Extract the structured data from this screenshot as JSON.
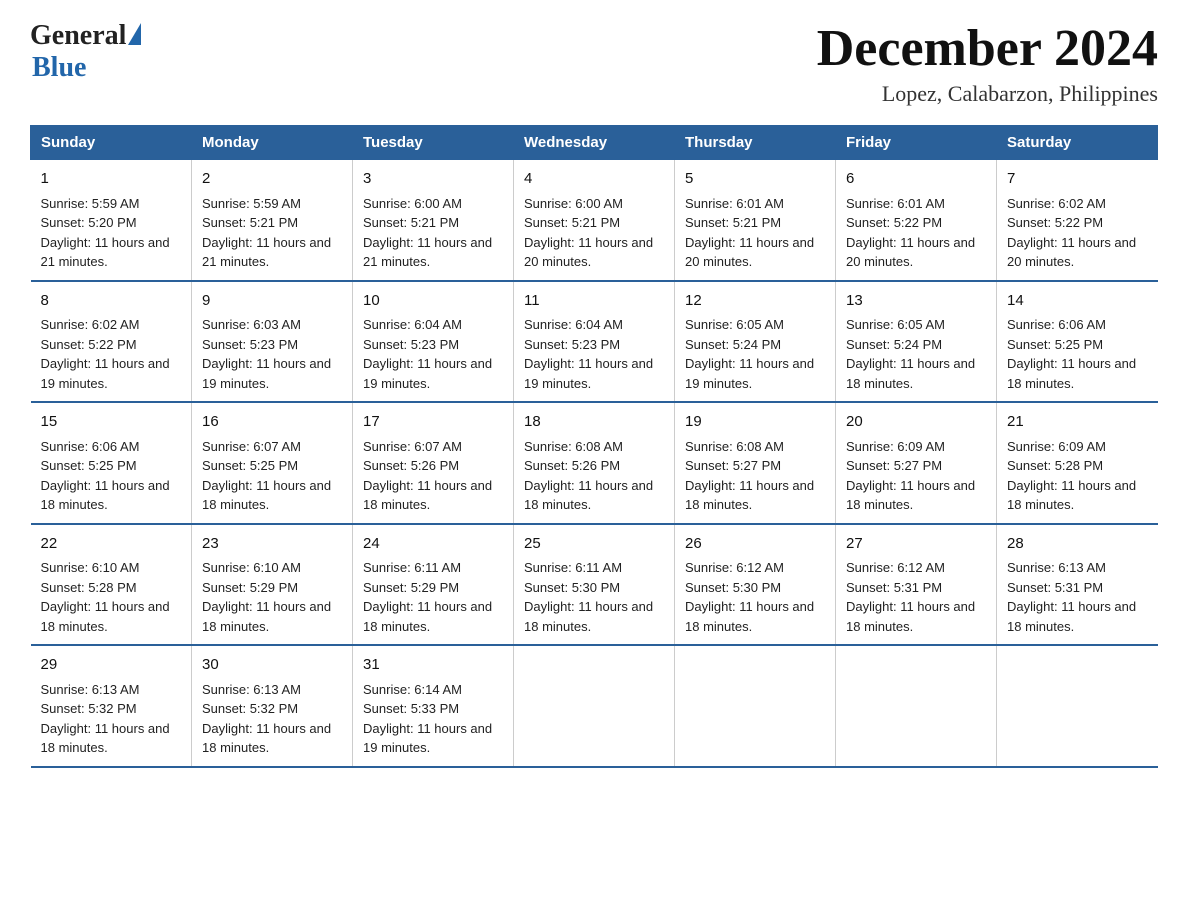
{
  "header": {
    "logo_general": "General",
    "logo_blue": "Blue",
    "month_title": "December 2024",
    "location": "Lopez, Calabarzon, Philippines"
  },
  "days_of_week": [
    "Sunday",
    "Monday",
    "Tuesday",
    "Wednesday",
    "Thursday",
    "Friday",
    "Saturday"
  ],
  "weeks": [
    [
      {
        "day": "1",
        "sunrise": "5:59 AM",
        "sunset": "5:20 PM",
        "daylight": "11 hours and 21 minutes."
      },
      {
        "day": "2",
        "sunrise": "5:59 AM",
        "sunset": "5:21 PM",
        "daylight": "11 hours and 21 minutes."
      },
      {
        "day": "3",
        "sunrise": "6:00 AM",
        "sunset": "5:21 PM",
        "daylight": "11 hours and 21 minutes."
      },
      {
        "day": "4",
        "sunrise": "6:00 AM",
        "sunset": "5:21 PM",
        "daylight": "11 hours and 20 minutes."
      },
      {
        "day": "5",
        "sunrise": "6:01 AM",
        "sunset": "5:21 PM",
        "daylight": "11 hours and 20 minutes."
      },
      {
        "day": "6",
        "sunrise": "6:01 AM",
        "sunset": "5:22 PM",
        "daylight": "11 hours and 20 minutes."
      },
      {
        "day": "7",
        "sunrise": "6:02 AM",
        "sunset": "5:22 PM",
        "daylight": "11 hours and 20 minutes."
      }
    ],
    [
      {
        "day": "8",
        "sunrise": "6:02 AM",
        "sunset": "5:22 PM",
        "daylight": "11 hours and 19 minutes."
      },
      {
        "day": "9",
        "sunrise": "6:03 AM",
        "sunset": "5:23 PM",
        "daylight": "11 hours and 19 minutes."
      },
      {
        "day": "10",
        "sunrise": "6:04 AM",
        "sunset": "5:23 PM",
        "daylight": "11 hours and 19 minutes."
      },
      {
        "day": "11",
        "sunrise": "6:04 AM",
        "sunset": "5:23 PM",
        "daylight": "11 hours and 19 minutes."
      },
      {
        "day": "12",
        "sunrise": "6:05 AM",
        "sunset": "5:24 PM",
        "daylight": "11 hours and 19 minutes."
      },
      {
        "day": "13",
        "sunrise": "6:05 AM",
        "sunset": "5:24 PM",
        "daylight": "11 hours and 18 minutes."
      },
      {
        "day": "14",
        "sunrise": "6:06 AM",
        "sunset": "5:25 PM",
        "daylight": "11 hours and 18 minutes."
      }
    ],
    [
      {
        "day": "15",
        "sunrise": "6:06 AM",
        "sunset": "5:25 PM",
        "daylight": "11 hours and 18 minutes."
      },
      {
        "day": "16",
        "sunrise": "6:07 AM",
        "sunset": "5:25 PM",
        "daylight": "11 hours and 18 minutes."
      },
      {
        "day": "17",
        "sunrise": "6:07 AM",
        "sunset": "5:26 PM",
        "daylight": "11 hours and 18 minutes."
      },
      {
        "day": "18",
        "sunrise": "6:08 AM",
        "sunset": "5:26 PM",
        "daylight": "11 hours and 18 minutes."
      },
      {
        "day": "19",
        "sunrise": "6:08 AM",
        "sunset": "5:27 PM",
        "daylight": "11 hours and 18 minutes."
      },
      {
        "day": "20",
        "sunrise": "6:09 AM",
        "sunset": "5:27 PM",
        "daylight": "11 hours and 18 minutes."
      },
      {
        "day": "21",
        "sunrise": "6:09 AM",
        "sunset": "5:28 PM",
        "daylight": "11 hours and 18 minutes."
      }
    ],
    [
      {
        "day": "22",
        "sunrise": "6:10 AM",
        "sunset": "5:28 PM",
        "daylight": "11 hours and 18 minutes."
      },
      {
        "day": "23",
        "sunrise": "6:10 AM",
        "sunset": "5:29 PM",
        "daylight": "11 hours and 18 minutes."
      },
      {
        "day": "24",
        "sunrise": "6:11 AM",
        "sunset": "5:29 PM",
        "daylight": "11 hours and 18 minutes."
      },
      {
        "day": "25",
        "sunrise": "6:11 AM",
        "sunset": "5:30 PM",
        "daylight": "11 hours and 18 minutes."
      },
      {
        "day": "26",
        "sunrise": "6:12 AM",
        "sunset": "5:30 PM",
        "daylight": "11 hours and 18 minutes."
      },
      {
        "day": "27",
        "sunrise": "6:12 AM",
        "sunset": "5:31 PM",
        "daylight": "11 hours and 18 minutes."
      },
      {
        "day": "28",
        "sunrise": "6:13 AM",
        "sunset": "5:31 PM",
        "daylight": "11 hours and 18 minutes."
      }
    ],
    [
      {
        "day": "29",
        "sunrise": "6:13 AM",
        "sunset": "5:32 PM",
        "daylight": "11 hours and 18 minutes."
      },
      {
        "day": "30",
        "sunrise": "6:13 AM",
        "sunset": "5:32 PM",
        "daylight": "11 hours and 18 minutes."
      },
      {
        "day": "31",
        "sunrise": "6:14 AM",
        "sunset": "5:33 PM",
        "daylight": "11 hours and 19 minutes."
      },
      null,
      null,
      null,
      null
    ]
  ],
  "labels": {
    "sunrise_prefix": "Sunrise: ",
    "sunset_prefix": "Sunset: ",
    "daylight_prefix": "Daylight: "
  }
}
